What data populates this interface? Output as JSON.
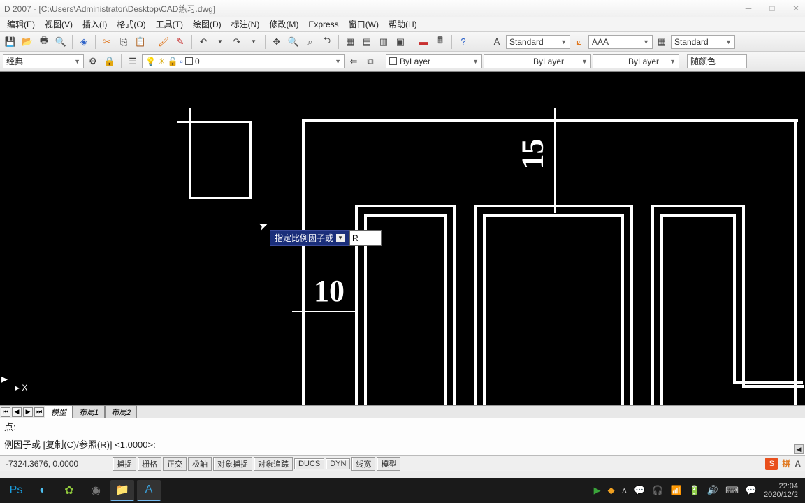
{
  "title": "D 2007 - [C:\\Users\\Administrator\\Desktop\\CAD练习.dwg]",
  "menu": [
    "编辑(E)",
    "视图(V)",
    "插入(I)",
    "格式(O)",
    "工具(T)",
    "绘图(D)",
    "标注(N)",
    "修改(M)",
    "Express",
    "窗口(W)",
    "帮助(H)"
  ],
  "styles": {
    "text": "Standard",
    "dim": "AAA",
    "table": "Standard"
  },
  "workspace": "经典",
  "layer_name": "0",
  "linetype": "ByLayer",
  "lineweight": "ByLayer",
  "plotstyle": "ByLayer",
  "color_label": "随颜色",
  "dyn_prompt": "指定比例因子或",
  "dyn_value": "R",
  "dim_text": {
    "ten": "10",
    "fifteen": "15"
  },
  "ucs_label": "X",
  "layout_tabs": [
    "模型",
    "布局1",
    "布局2"
  ],
  "cmd": {
    "line1": "点:",
    "line2": "例因子或 [复制(C)/参照(R)] <1.0000>:"
  },
  "coords": "-7324.3676, 0.0000",
  "status_btns": [
    "捕捉",
    "栅格",
    "正交",
    "极轴",
    "对象捕捉",
    "对象追踪",
    "DUCS",
    "DYN",
    "线宽",
    "模型"
  ],
  "clock": {
    "time": "22:04",
    "date": "2020/12/2"
  },
  "ime": {
    "box": "S",
    "pinyin": "拼",
    "a": "A"
  }
}
